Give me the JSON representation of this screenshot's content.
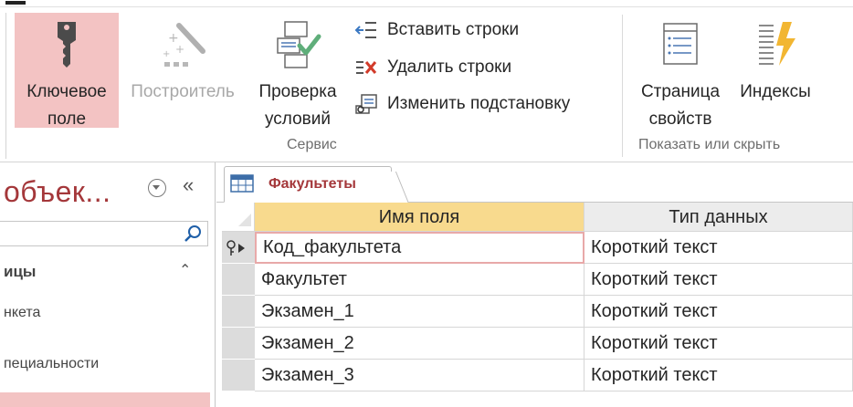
{
  "ribbon": {
    "buttons": {
      "primary_key": {
        "line1": "Ключевое",
        "line2": "поле"
      },
      "builder": {
        "line1": "Построитель"
      },
      "validate": {
        "line1": "Проверка",
        "line2": "условий"
      },
      "insert_rows": "Вставить строки",
      "delete_rows": "Удалить строки",
      "modify_lookup": "Изменить подстановку",
      "property_sheet": {
        "line1": "Страница",
        "line2": "свойств"
      },
      "indexes": {
        "line1": "Индексы"
      }
    },
    "groups": {
      "tools": "Сервис",
      "show_hide": "Показать или скрыть"
    }
  },
  "nav": {
    "title": "объек...",
    "collapse_glyph": "«",
    "section": "ицы",
    "section_chevron": "⌃",
    "items": [
      "нкета",
      "пециальности"
    ]
  },
  "doc": {
    "tab_label": "Факультеты",
    "columns": {
      "field_name": "Имя поля",
      "data_type": "Тип данных"
    },
    "rows": [
      {
        "field": "Код_факультета",
        "type": "Короткий текст",
        "primary_key": true
      },
      {
        "field": "Факультет",
        "type": "Короткий текст"
      },
      {
        "field": "Экзамен_1",
        "type": "Короткий текст"
      },
      {
        "field": "Экзамен_2",
        "type": "Короткий текст"
      },
      {
        "field": "Экзамен_3",
        "type": "Короткий текст"
      }
    ]
  },
  "colors": {
    "accent_text": "#a4373a",
    "selected_button": "#f3c3c3",
    "header_highlight": "#f8da8e",
    "lightning": "#f2b632"
  },
  "icons": [
    "key-icon",
    "builder-wand-icon",
    "validation-rules-icon",
    "insert-rows-icon",
    "delete-rows-icon",
    "modify-lookups-icon",
    "property-sheet-icon",
    "indexes-icon",
    "dropdown-circle-icon",
    "search-icon",
    "table-icon",
    "primary-key-row-icon"
  ]
}
